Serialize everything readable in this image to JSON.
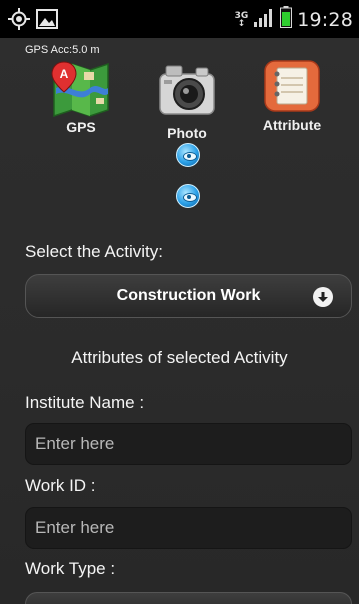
{
  "status_bar": {
    "network_type": "3G",
    "time": "19:28",
    "colors": {
      "battery": "#2ecc2e",
      "signal": "#d8d8d8"
    },
    "icons": [
      "gps-target-icon",
      "image-icon",
      "signal-icon",
      "battery-icon"
    ]
  },
  "gps_accuracy": "GPS Acc:5.0 m",
  "actions": {
    "gps_label": "GPS",
    "photo_label": "Photo",
    "attribute_label": "Attribute"
  },
  "activity": {
    "label": "Select the Activity:",
    "selected": "Construction Work"
  },
  "attributes_heading": "Attributes of selected Activity",
  "fields": {
    "institute_name": {
      "label": "Institute Name :",
      "placeholder": "Enter here",
      "value": ""
    },
    "work_id": {
      "label": "Work ID :",
      "placeholder": "Enter here",
      "value": ""
    },
    "work_type": {
      "label": "Work Type :"
    }
  }
}
